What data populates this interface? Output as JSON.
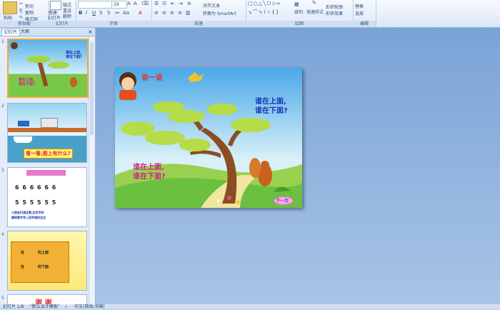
{
  "ribbon": {
    "clipboard": {
      "paste": "粘贴",
      "cut": "剪切",
      "copy": "复制",
      "format_painter": "格式刷",
      "label": "剪贴板"
    },
    "slides": {
      "new_slide": "新建",
      "new_slide2": "幻灯片",
      "layout": "版式",
      "reset": "重设",
      "delete": "删除",
      "label": "幻灯片"
    },
    "font": {
      "size": "28",
      "label": "字体"
    },
    "paragraph": {
      "align_text": "对齐文本",
      "smartart": "转换为 SmartArt",
      "label": "段落"
    },
    "drawing": {
      "arrange": "排列",
      "quick_styles": "快速样式",
      "shape_fill": "形状轮廓",
      "shape_effects": "形状效果",
      "label": "绘图"
    },
    "editing": {
      "replace": "替换",
      "select": "选择",
      "label": "编辑"
    }
  },
  "panel": {
    "tab_slides": "幻灯片",
    "tab_outline": "大纲",
    "close": "×"
  },
  "thumbnails": [
    {
      "num": "1",
      "line1": "谁在上面,",
      "line2": "谁在下面?"
    },
    {
      "num": "2",
      "caption": "看一看,图上有什么?"
    },
    {
      "num": "3",
      "top": "",
      "row1": "6 6 6 6 6 6",
      "row2": "5 5 5 5 5 5",
      "note1": "小朋友们请注意,在写字时",
      "note2": "要把数字写入田字格的左边"
    },
    {
      "num": "4",
      "l1": "在",
      "l2": "的上面",
      "l3": "在",
      "l4": "的下面"
    },
    {
      "num": "5",
      "text": "谢 谢"
    }
  ],
  "slide": {
    "title": "说一说",
    "q_right_1": "谁在上面,",
    "q_right_2": "谁在下面?",
    "q_left_1": "谁在上面,",
    "q_left_2": "谁在下面?",
    "next": "下一页"
  },
  "status": {
    "slide_count": "幻灯片 1/6",
    "theme": "\"默认设计模板\"",
    "language": "中文(简体,中国)"
  },
  "colors": {
    "sky_top": "#4aa8e8",
    "sky_bottom": "#d8f0f8",
    "grass": "#6cc040",
    "title_red": "#e0303a",
    "blue_text": "#1533b8",
    "magenta_text": "#d0208c"
  }
}
